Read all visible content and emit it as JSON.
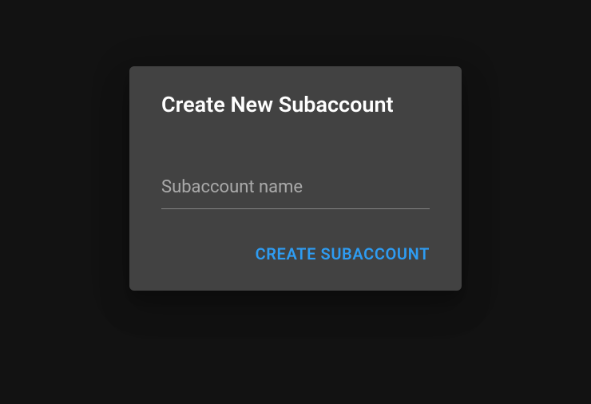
{
  "dialog": {
    "title": "Create New Subaccount",
    "input": {
      "placeholder": "Subaccount name",
      "value": ""
    },
    "actions": {
      "submit_label": "Create Subaccount"
    }
  }
}
